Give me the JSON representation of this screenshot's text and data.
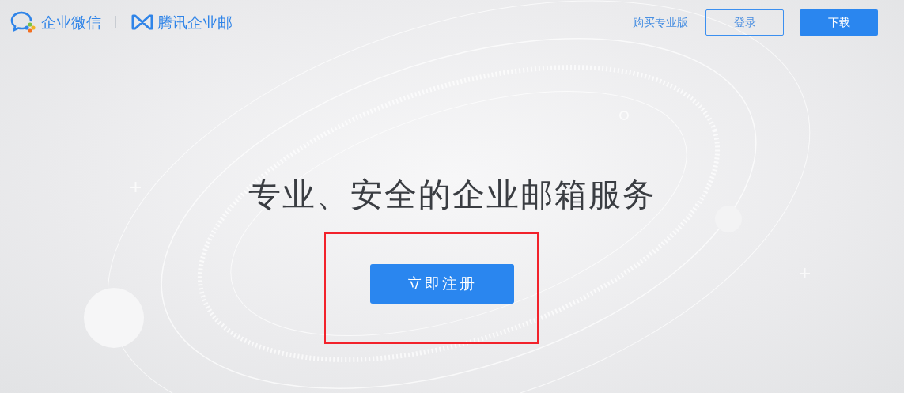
{
  "header": {
    "brands": [
      {
        "kind": "wework",
        "label": "企业微信"
      },
      {
        "kind": "exmail",
        "label": "腾讯企业邮"
      }
    ],
    "links": [
      {
        "kind": "link",
        "label": "购买专业版"
      },
      {
        "kind": "outline",
        "label": "登录"
      },
      {
        "kind": "primary",
        "label": "下载"
      }
    ]
  },
  "hero": {
    "title": "专业、安全的企业邮箱服务",
    "cta": {
      "label": "立即注册",
      "highlighted": true
    }
  }
}
